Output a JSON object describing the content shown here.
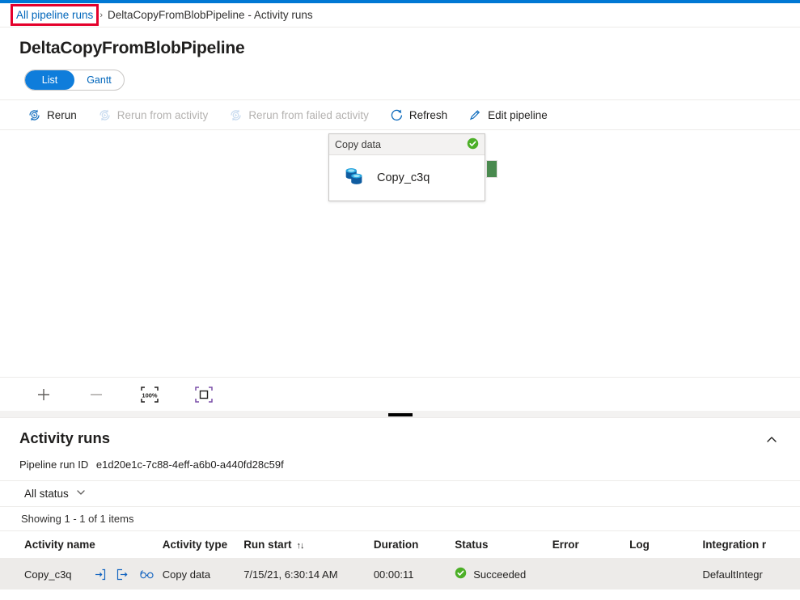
{
  "breadcrumb": {
    "link_label": "All pipeline runs",
    "separator": "›",
    "current_label": "DeltaCopyFromBlobPipeline - Activity runs",
    "highlight_color": "#e4002b"
  },
  "page": {
    "title": "DeltaCopyFromBlobPipeline",
    "accent_color": "#0078d4"
  },
  "view_toggle": {
    "options": [
      {
        "label": "List",
        "selected": true
      },
      {
        "label": "Gantt",
        "selected": false
      }
    ],
    "active_bg": "#0f7ddb"
  },
  "command_bar": {
    "items": [
      {
        "label": "Rerun",
        "icon": "rerun-icon",
        "disabled": false
      },
      {
        "label": "Rerun from activity",
        "icon": "rerun-from-activity-icon",
        "disabled": true
      },
      {
        "label": "Rerun from failed activity",
        "icon": "rerun-from-failed-activity-icon",
        "disabled": true
      },
      {
        "label": "Refresh",
        "icon": "refresh-icon",
        "disabled": false
      },
      {
        "label": "Edit pipeline",
        "icon": "pencil-icon",
        "disabled": false
      }
    ]
  },
  "canvas": {
    "activity_card": {
      "type_label": "Copy data",
      "name": "Copy_c3q",
      "status_icon": "success-check-icon",
      "status_color": "#4caf27",
      "icon": "copy-data-icon",
      "output_handle_color": "#4a8a4f"
    },
    "tools": [
      {
        "name": "zoom-in-icon",
        "label": "+"
      },
      {
        "name": "zoom-out-icon",
        "label": "−"
      },
      {
        "name": "zoom-to-100-percent-icon",
        "label": "100%"
      },
      {
        "name": "zoom-to-fit-icon",
        "label": "fit"
      }
    ]
  },
  "activity_runs": {
    "title": "Activity runs",
    "collapse_icon": "chevron-up-icon",
    "run_id_label": "Pipeline run ID",
    "run_id_value": "e1d20e1c-7c88-4eff-a6b0-a440fd28c59f",
    "status_filter": {
      "label": "All status",
      "icon": "chevron-down-icon"
    },
    "showing_text": "Showing 1 - 1 of 1 items",
    "columns": [
      "Activity name",
      "Activity type",
      "Run start",
      "Duration",
      "Status",
      "Error",
      "Log",
      "Integration r"
    ],
    "sort_column": "Run start",
    "sort_glyph": "↑↓",
    "row_actions": [
      "input-icon",
      "output-icon",
      "details-glasses-icon"
    ],
    "rows": [
      {
        "activity_name": "Copy_c3q",
        "activity_type": "Copy data",
        "run_start": "7/15/21, 6:30:14 AM",
        "duration": "00:00:11",
        "status": "Succeeded",
        "status_color": "#4caf27",
        "error": "",
        "log": "",
        "integration_runtime": "DefaultIntegr"
      }
    ]
  }
}
